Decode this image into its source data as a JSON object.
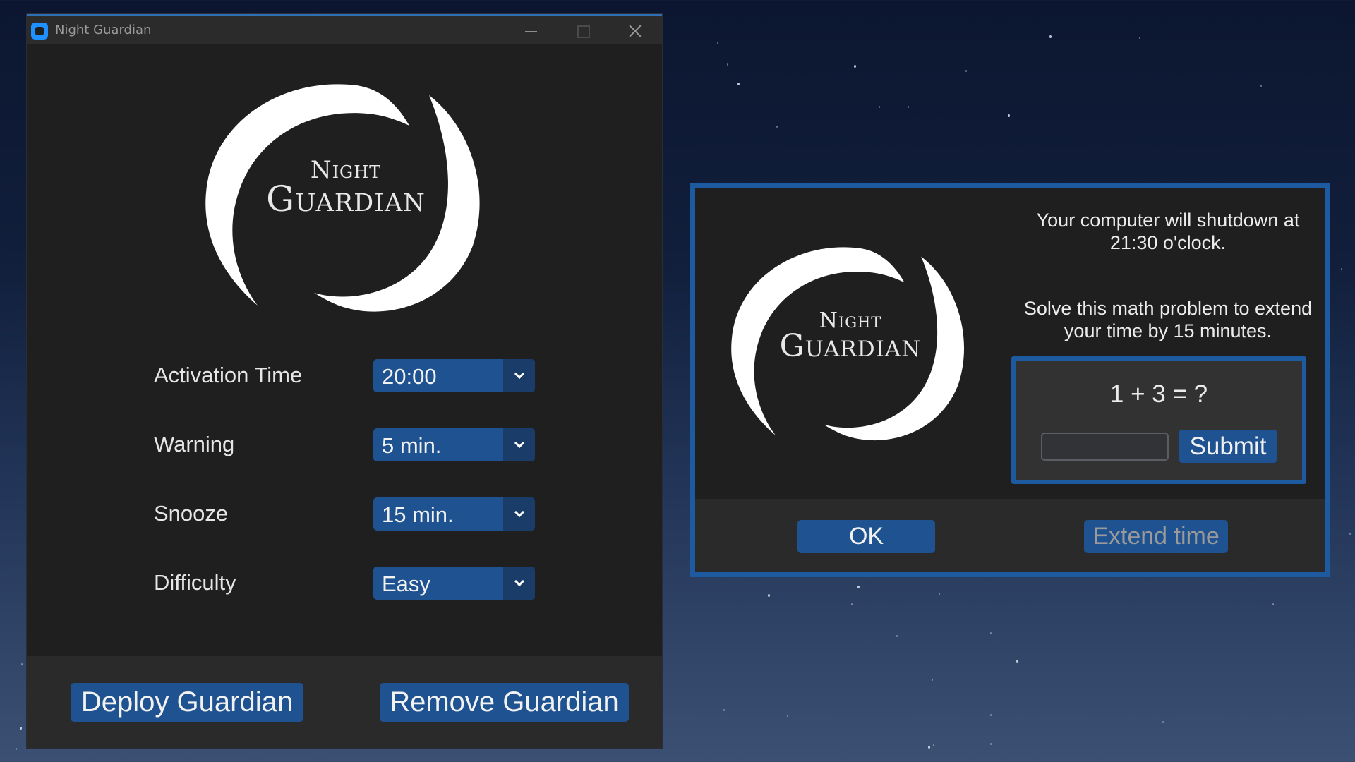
{
  "main_window": {
    "title": "Night Guardian",
    "logo": {
      "line1": "Night",
      "line2": "Guardian"
    },
    "settings": [
      {
        "label": "Activation Time",
        "value": "20:00"
      },
      {
        "label": "Warning",
        "value": "5 min."
      },
      {
        "label": "Snooze",
        "value": "15 min."
      },
      {
        "label": "Difficulty",
        "value": "Easy"
      }
    ],
    "buttons": {
      "deploy": "Deploy Guardian",
      "remove": "Remove Guardian"
    }
  },
  "dialog": {
    "logo": {
      "line1": "Night",
      "line2": "Guardian"
    },
    "shutdown_message": "Your computer will shutdown at 21:30 o'clock.",
    "extend_message": "Solve this math problem to extend your time by 15 minutes.",
    "problem": "1 + 3 = ?",
    "answer_value": "",
    "submit_label": "Submit",
    "ok_label": "OK",
    "extend_label": "Extend time"
  },
  "colors": {
    "accent": "#1f5290",
    "border_accent": "#1d5aa0",
    "window_bg": "#1f1f1f",
    "disabled_text": "#9a9a9a"
  }
}
